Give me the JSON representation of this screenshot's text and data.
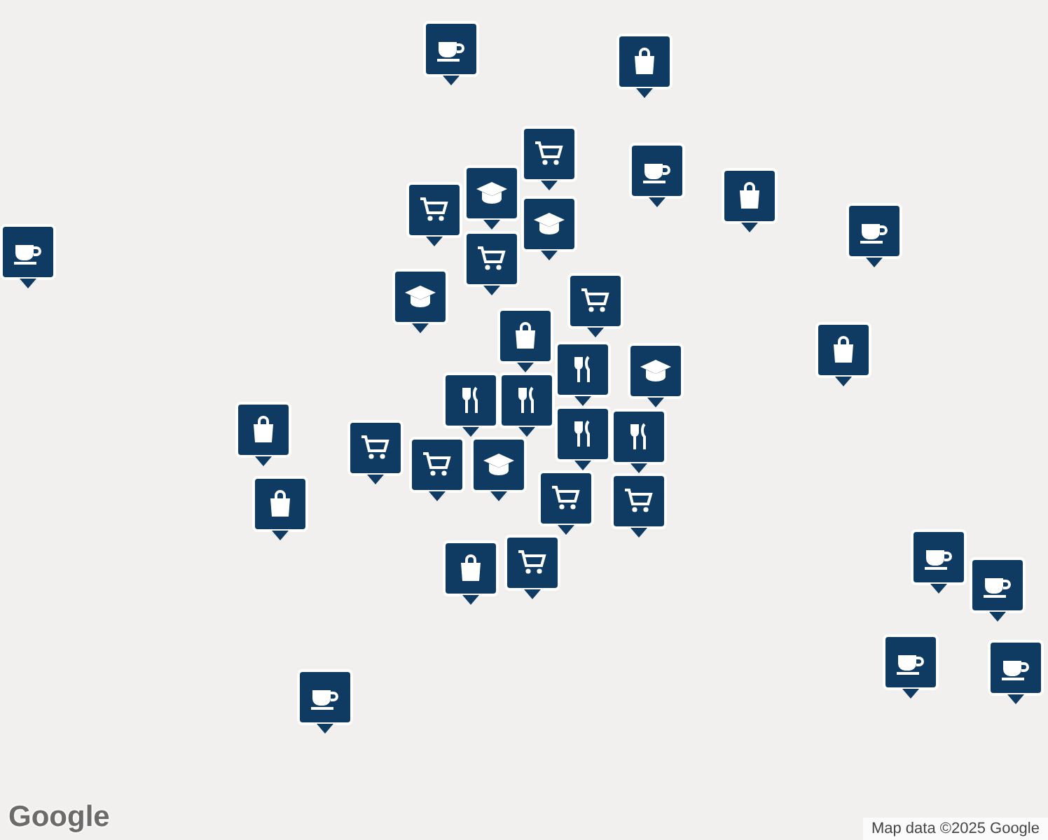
{
  "map": {
    "pins": [
      {
        "kind": "cafe"
      },
      {
        "kind": "cafe"
      },
      {
        "kind": "cafe"
      },
      {
        "kind": "cafe"
      },
      {
        "kind": "cafe"
      },
      {
        "kind": "cafe"
      },
      {
        "kind": "cafe"
      },
      {
        "kind": "cafe"
      },
      {
        "kind": "cafe"
      },
      {
        "kind": "bag"
      },
      {
        "kind": "bag"
      },
      {
        "kind": "bag"
      },
      {
        "kind": "bag"
      },
      {
        "kind": "bag"
      },
      {
        "kind": "bag"
      },
      {
        "kind": "bag"
      },
      {
        "kind": "cart"
      },
      {
        "kind": "cart"
      },
      {
        "kind": "cart"
      },
      {
        "kind": "cart"
      },
      {
        "kind": "cart"
      },
      {
        "kind": "cart"
      },
      {
        "kind": "cart"
      },
      {
        "kind": "cart"
      },
      {
        "kind": "cart"
      },
      {
        "kind": "school"
      },
      {
        "kind": "school"
      },
      {
        "kind": "school"
      },
      {
        "kind": "school"
      },
      {
        "kind": "school"
      },
      {
        "kind": "restaurant"
      },
      {
        "kind": "restaurant"
      },
      {
        "kind": "restaurant"
      },
      {
        "kind": "restaurant"
      },
      {
        "kind": "restaurant"
      }
    ]
  },
  "logo": "Google",
  "attribution": "Map data ©2025 Google"
}
